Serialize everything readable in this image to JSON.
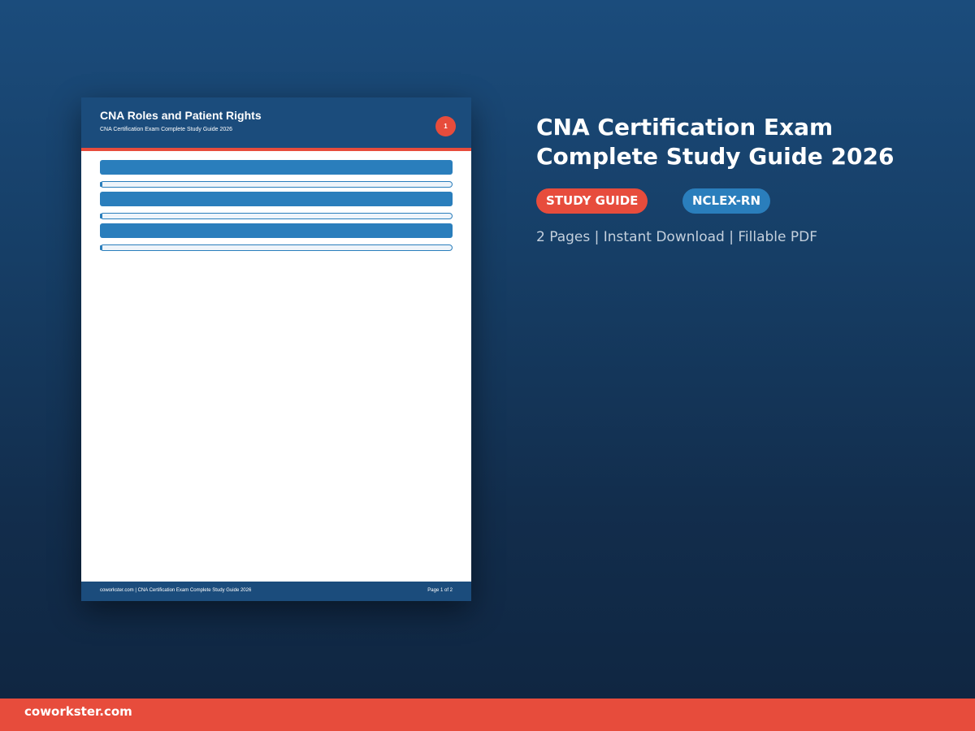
{
  "colors": {
    "background_top": "#1b4c7c",
    "background_bottom": "#0f2540",
    "accent_red": "#e74c3c",
    "accent_blue": "#2a7ebc",
    "header_navy": "#1b4c7c"
  },
  "document_preview": {
    "title": "CNA Roles and Patient Rights",
    "subtitle": "CNA Certification Exam Complete Study Guide 2026",
    "page_badge": "1",
    "footer_text": "coworkster.com | CNA Certification Exam Complete Study Guide 2026",
    "footer_page": "Page 1 of 2"
  },
  "product": {
    "title_line1": "CNA Certification Exam",
    "title_line2": "Complete Study Guide 2026",
    "badges": [
      "STUDY GUIDE",
      "NCLEX-RN"
    ],
    "meta": "2 Pages | Instant Download | Fillable PDF"
  },
  "brand": {
    "name": "coworkster.com"
  }
}
